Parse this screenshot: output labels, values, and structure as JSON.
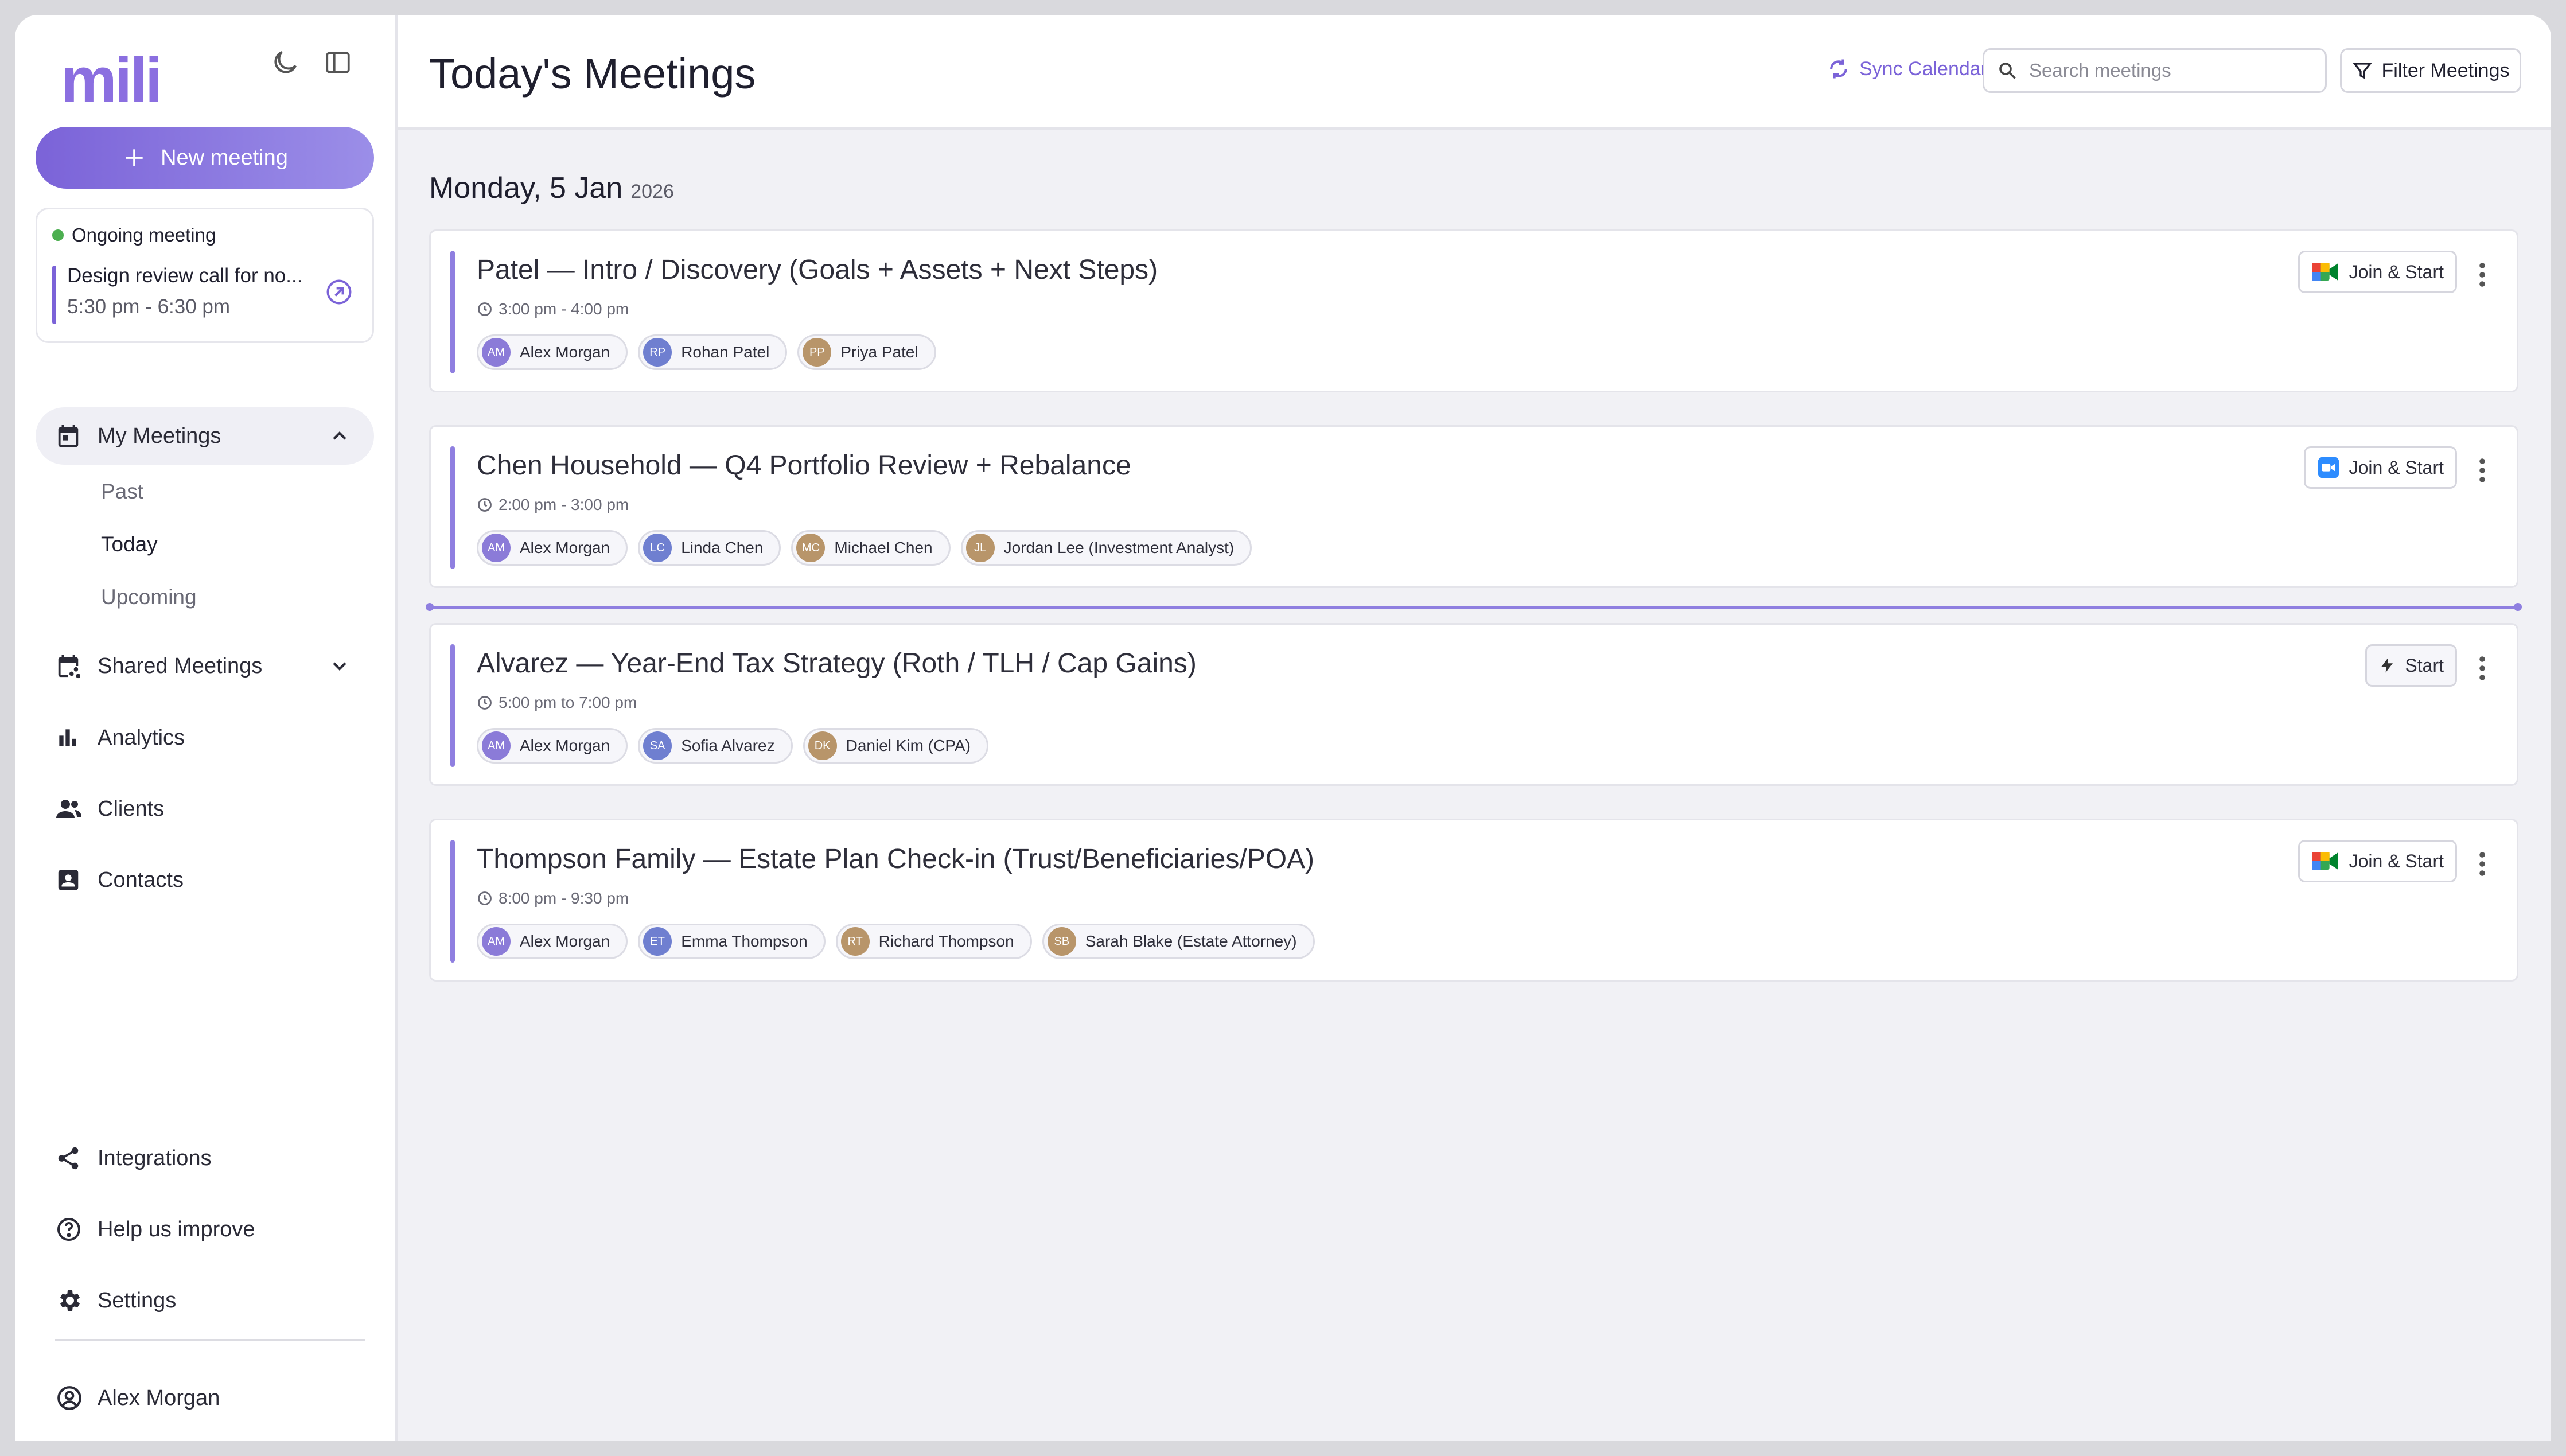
{
  "app": {
    "logo": "mili",
    "new_meeting_label": "New meeting",
    "accent": "#7b63d8"
  },
  "ongoing": {
    "status": "Ongoing meeting",
    "title": "Design review call for no...",
    "time": "5:30 pm - 6:30 pm"
  },
  "nav": {
    "my_meetings": "My Meetings",
    "sub": {
      "past": "Past",
      "today": "Today",
      "upcoming": "Upcoming"
    },
    "shared_meetings": "Shared Meetings",
    "analytics": "Analytics",
    "clients": "Clients",
    "contacts": "Contacts",
    "integrations": "Integrations",
    "help": "Help us improve",
    "settings": "Settings",
    "user": "Alex Morgan"
  },
  "header": {
    "title": "Today's Meetings",
    "sync_label": "Sync Calendar",
    "search_placeholder": "Search meetings",
    "filter_label": "Filter Meetings"
  },
  "date": {
    "day": "Monday, 5 Jan",
    "year": "2026"
  },
  "meetings": [
    {
      "title": "Patel — Intro / Discovery (Goals + Assets + Next Steps)",
      "time": "3:00 pm - 4:00 pm",
      "action": "Join & Start",
      "provider": "google-meet-icon",
      "attendees": [
        {
          "initials": "AM",
          "name": "Alex Morgan"
        },
        {
          "initials": "RP",
          "name": "Rohan Patel"
        },
        {
          "initials": "PP",
          "name": "Priya Patel"
        }
      ]
    },
    {
      "title": "Chen Household — Q4 Portfolio Review + Rebalance",
      "time": "2:00 pm - 3:00 pm",
      "action": "Join & Start",
      "provider": "zoom-icon",
      "attendees": [
        {
          "initials": "AM",
          "name": "Alex Morgan"
        },
        {
          "initials": "LC",
          "name": "Linda Chen"
        },
        {
          "initials": "MC",
          "name": "Michael Chen"
        },
        {
          "initials": "JL",
          "name": "Jordan Lee (Investment Analyst)"
        }
      ]
    },
    {
      "title": "Alvarez — Year-End Tax Strategy (Roth / TLH / Cap Gains)",
      "time": "5:00 pm to 7:00 pm",
      "action": "Start",
      "provider": "bolt-icon",
      "attendees": [
        {
          "initials": "AM",
          "name": "Alex Morgan"
        },
        {
          "initials": "SA",
          "name": "Sofia Alvarez"
        },
        {
          "initials": "DK",
          "name": "Daniel Kim (CPA)"
        }
      ]
    },
    {
      "title": "Thompson Family — Estate Plan Check-in (Trust/Beneficiaries/POA)",
      "time": "8:00 pm - 9:30 pm",
      "action": "Join & Start",
      "provider": "google-meet-icon",
      "attendees": [
        {
          "initials": "AM",
          "name": "Alex Morgan"
        },
        {
          "initials": "ET",
          "name": "Emma Thompson"
        },
        {
          "initials": "RT",
          "name": "Richard Thompson"
        },
        {
          "initials": "SB",
          "name": "Sarah Blake (Estate Attorney)"
        }
      ]
    }
  ]
}
